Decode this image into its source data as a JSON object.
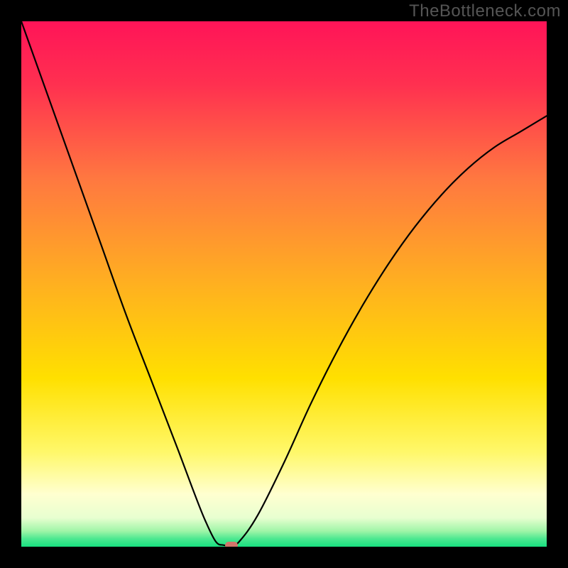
{
  "watermark": "TheBottleneck.com",
  "chart_data": {
    "type": "line",
    "title": "",
    "xlabel": "",
    "ylabel": "",
    "xlim": [
      0,
      100
    ],
    "ylim": [
      0,
      100
    ],
    "grid": false,
    "legend": false,
    "gradient_stops": [
      {
        "offset": 0,
        "color": "#ff1458"
      },
      {
        "offset": 0.12,
        "color": "#ff3050"
      },
      {
        "offset": 0.3,
        "color": "#ff7840"
      },
      {
        "offset": 0.5,
        "color": "#ffb020"
      },
      {
        "offset": 0.68,
        "color": "#ffe000"
      },
      {
        "offset": 0.82,
        "color": "#fff86a"
      },
      {
        "offset": 0.9,
        "color": "#ffffd0"
      },
      {
        "offset": 0.945,
        "color": "#e8ffd0"
      },
      {
        "offset": 0.97,
        "color": "#a0f5a8"
      },
      {
        "offset": 0.985,
        "color": "#4ce890"
      },
      {
        "offset": 1.0,
        "color": "#18e080"
      }
    ],
    "series": [
      {
        "name": "bottleneck-curve",
        "color": "#000000",
        "x": [
          0,
          5,
          10,
          15,
          20,
          25,
          30,
          33,
          35,
          37,
          38.5,
          40,
          41.5,
          45,
          50,
          55,
          60,
          65,
          70,
          75,
          80,
          85,
          90,
          95,
          100
        ],
        "y": [
          100,
          86,
          72,
          58,
          44,
          31,
          18,
          10,
          5,
          1,
          0.3,
          0.3,
          1,
          6,
          16,
          27,
          37,
          46,
          54,
          61,
          67,
          72,
          76,
          79,
          82
        ]
      }
    ],
    "marker": {
      "x": 40,
      "y": 0.3,
      "color": "#d3756b"
    }
  }
}
